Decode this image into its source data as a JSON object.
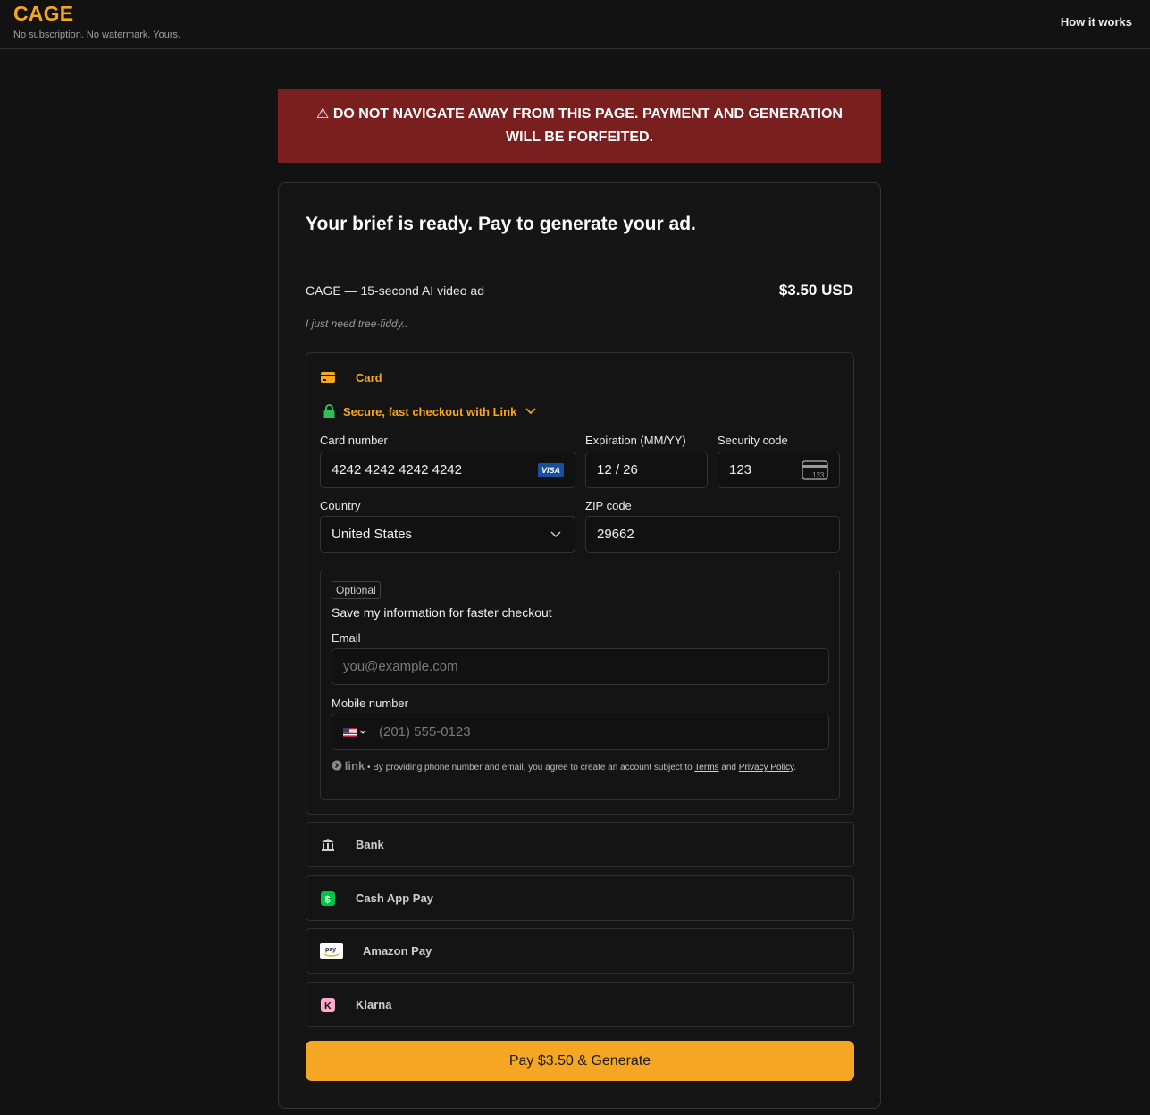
{
  "header": {
    "brand": "CAGE",
    "tagline": "No subscription. No watermark. Yours.",
    "nav_link": "How it works"
  },
  "warning": {
    "text": "⚠ DO NOT NAVIGATE AWAY FROM THIS PAGE. PAYMENT AND GENERATION WILL BE FORFEITED."
  },
  "checkout": {
    "title": "Your brief is ready. Pay to generate your ad.",
    "product": "CAGE — 15-second AI video ad",
    "price": "$3.50 USD",
    "note": "I just need tree-fiddy.."
  },
  "payment": {
    "card_tab": "Card",
    "link_text": "Secure, fast checkout with Link",
    "card_number_label": "Card number",
    "card_number": "4242 4242 4242 4242",
    "card_brand": "VISA",
    "expiration_label": "Expiration (MM/YY)",
    "expiration": "12 / 26",
    "security_label": "Security code",
    "security": "123",
    "country_label": "Country",
    "country": "United States",
    "zip_label": "ZIP code",
    "zip": "29662",
    "optional_badge": "Optional",
    "save_text": "Save my information for faster checkout",
    "email_label": "Email",
    "email_placeholder": "you@example.com",
    "mobile_label": "Mobile number",
    "mobile_placeholder": "(201) 555-0123",
    "link_logo": "link",
    "legal_prefix": " • By providing phone number and email, you agree to create an account subject to ",
    "terms": "Terms",
    "legal_and": " and ",
    "privacy": "Privacy Policy",
    "legal_suffix": "."
  },
  "methods": [
    {
      "label": "Bank",
      "icon": "bank-icon"
    },
    {
      "label": "Cash App Pay",
      "icon": "cash-app-icon"
    },
    {
      "label": "Amazon Pay",
      "icon": "amazon-pay-icon"
    },
    {
      "label": "Klarna",
      "icon": "klarna-icon"
    }
  ],
  "pay_button": "Pay $3.50 & Generate",
  "colors": {
    "accent": "#f5a623",
    "warning_bg": "#7a1f1f",
    "background": "#121212",
    "link_green": "#2dbf5a"
  }
}
